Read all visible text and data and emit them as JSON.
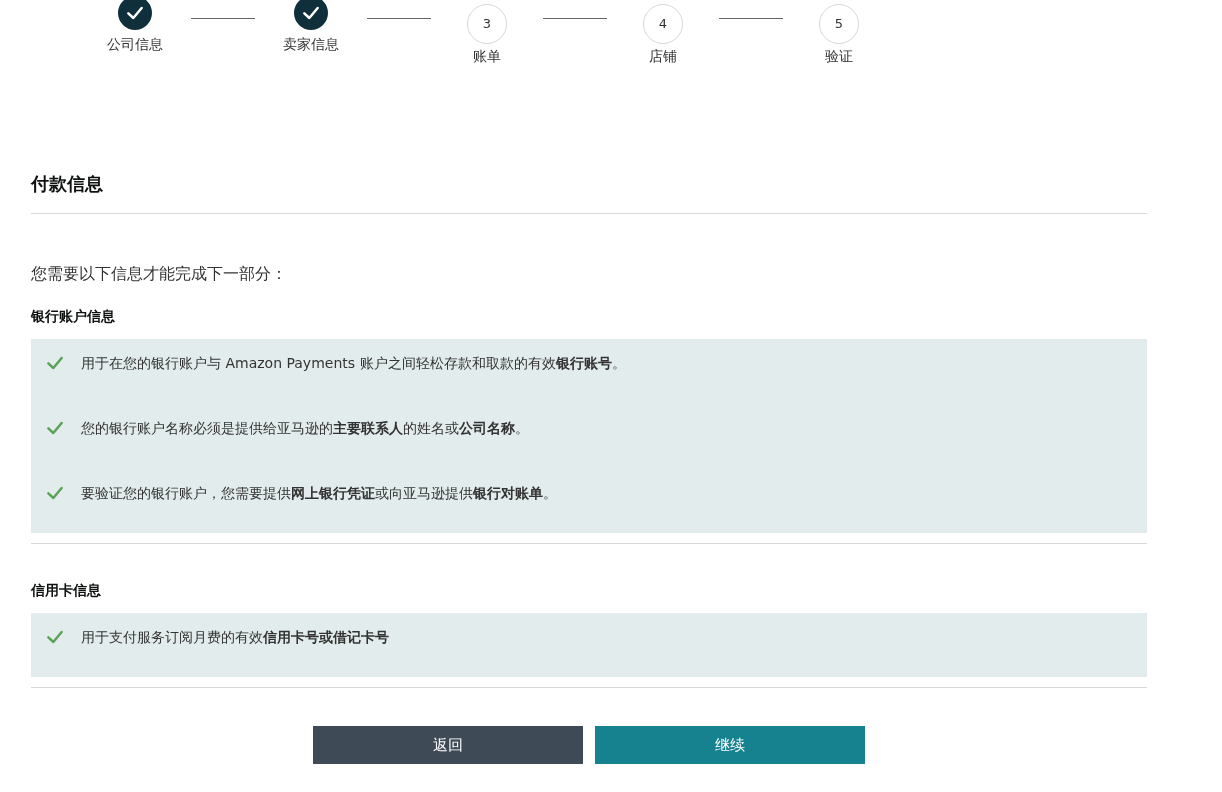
{
  "steps": [
    {
      "label": "公司信息",
      "completed": true
    },
    {
      "label": "卖家信息",
      "completed": true
    },
    {
      "number": "3",
      "label": "账单",
      "completed": false
    },
    {
      "number": "4",
      "label": "店铺",
      "completed": false
    },
    {
      "number": "5",
      "label": "验证",
      "completed": false
    }
  ],
  "page_title": "付款信息",
  "intro": "您需要以下信息才能完成下一部分：",
  "sections": [
    {
      "heading": "银行账户信息",
      "items": [
        "用于在您的银行账户与 Amazon Payments 账户之间轻松存款和取款的有效**银行账号**。",
        "您的银行账户名称必须是提供给亚马逊的**主要联系人**的姓名或**公司名称**。",
        "要验证您的银行账户，您需要提供**网上银行凭证**或向亚马逊提供**银行对账单**。"
      ]
    },
    {
      "heading": "信用卡信息",
      "items": [
        "用于支付服务订阅月费的有效**信用卡号或借记卡号**"
      ]
    }
  ],
  "buttons": [
    {
      "label": "返回",
      "kind": "secondary"
    },
    {
      "label": "继续",
      "kind": "primary"
    }
  ]
}
